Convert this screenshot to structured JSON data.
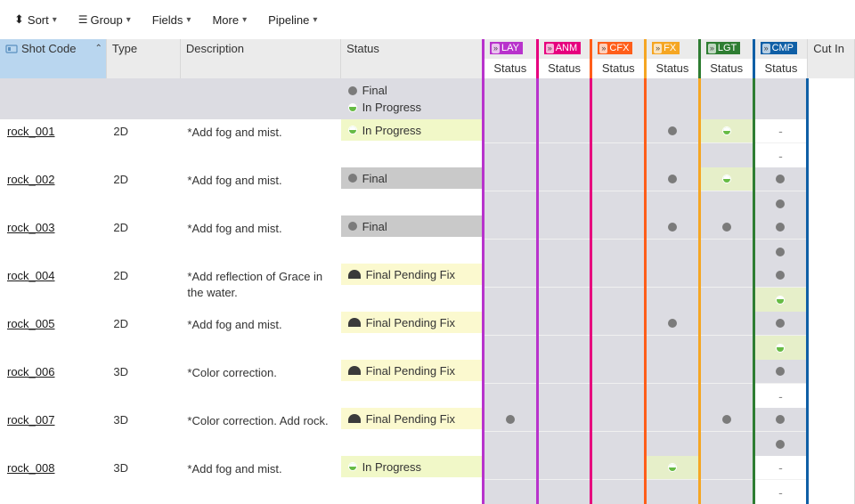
{
  "toolbar": {
    "sort": "Sort",
    "group": "Group",
    "fields": "Fields",
    "more": "More",
    "pipeline": "Pipeline"
  },
  "headers": {
    "shot_code": "Shot Code",
    "type": "Type",
    "description": "Description",
    "status": "Status",
    "cut_in": "Cut In"
  },
  "pipeline_steps": [
    {
      "code": "LAY",
      "color": "#b833cc"
    },
    {
      "code": "ANM",
      "color": "#e6007e"
    },
    {
      "code": "CFX",
      "color": "#ff5e1a"
    },
    {
      "code": "FX",
      "color": "#f5a623"
    },
    {
      "code": "LGT",
      "color": "#2e7d32"
    },
    {
      "code": "CMP",
      "color": "#0f5fa6"
    }
  ],
  "sub_header": "Status",
  "summary": {
    "line1": {
      "icon": "dot-grey",
      "label": "Final"
    },
    "line2": {
      "icon": "dot-green",
      "label": "In Progress"
    }
  },
  "status_labels": {
    "in_progress": "In Progress",
    "final": "Final",
    "final_pending_fix": "Final Pending Fix"
  },
  "rows": [
    {
      "shot": "rock_001",
      "type": "2D",
      "desc": "*Add fog and mist.",
      "status": {
        "kind": "in_progress",
        "label": "In Progress"
      },
      "pipe": [
        {
          "subs": [
            null,
            null
          ]
        },
        {
          "subs": [
            null,
            null
          ]
        },
        {
          "subs": [
            null,
            null
          ]
        },
        {
          "subs": [
            {
              "dot": "grey"
            },
            null
          ]
        },
        {
          "subs": [
            {
              "dot": "green"
            },
            null
          ]
        },
        {
          "subs": [
            {
              "dot": "dash"
            },
            {
              "dot": "dash"
            }
          ]
        }
      ]
    },
    {
      "shot": "rock_002",
      "type": "2D",
      "desc": "*Add fog and mist.",
      "status": {
        "kind": "final",
        "label": "Final"
      },
      "pipe": [
        {
          "subs": [
            null,
            null
          ]
        },
        {
          "subs": [
            null,
            null
          ]
        },
        {
          "subs": [
            null,
            null
          ]
        },
        {
          "subs": [
            {
              "dot": "grey"
            },
            null
          ]
        },
        {
          "subs": [
            {
              "dot": "green"
            },
            null
          ]
        },
        {
          "subs": [
            {
              "dot": "grey"
            },
            {
              "dot": "grey"
            }
          ]
        }
      ]
    },
    {
      "shot": "rock_003",
      "type": "2D",
      "desc": "*Add fog and mist.",
      "status": {
        "kind": "final",
        "label": "Final"
      },
      "pipe": [
        {
          "subs": [
            null,
            null
          ]
        },
        {
          "subs": [
            null,
            null
          ]
        },
        {
          "subs": [
            null,
            null
          ]
        },
        {
          "subs": [
            {
              "dot": "grey"
            },
            null
          ]
        },
        {
          "subs": [
            {
              "dot": "grey"
            },
            null
          ]
        },
        {
          "subs": [
            {
              "dot": "grey"
            },
            {
              "dot": "grey"
            }
          ]
        }
      ]
    },
    {
      "shot": "rock_004",
      "type": "2D",
      "desc": "*Add reflection of Grace in the water.",
      "status": {
        "kind": "pending",
        "label": "Final Pending Fix"
      },
      "pipe": [
        {
          "subs": [
            null,
            null
          ]
        },
        {
          "subs": [
            null,
            null
          ]
        },
        {
          "subs": [
            null,
            null
          ]
        },
        {
          "subs": [
            null,
            null
          ]
        },
        {
          "subs": [
            null,
            null
          ]
        },
        {
          "subs": [
            {
              "dot": "grey"
            },
            {
              "dot": "green"
            }
          ]
        }
      ]
    },
    {
      "shot": "rock_005",
      "type": "2D",
      "desc": "*Add fog and mist.",
      "status": {
        "kind": "pending",
        "label": "Final Pending Fix"
      },
      "pipe": [
        {
          "subs": [
            null,
            null
          ]
        },
        {
          "subs": [
            null,
            null
          ]
        },
        {
          "subs": [
            null,
            null
          ]
        },
        {
          "subs": [
            {
              "dot": "grey"
            },
            null
          ]
        },
        {
          "subs": [
            null,
            null
          ]
        },
        {
          "subs": [
            {
              "dot": "grey"
            },
            {
              "dot": "green"
            }
          ]
        }
      ]
    },
    {
      "shot": "rock_006",
      "type": "3D",
      "desc": "*Color correction.",
      "status": {
        "kind": "pending",
        "label": "Final Pending Fix"
      },
      "pipe": [
        {
          "subs": [
            null,
            null
          ]
        },
        {
          "subs": [
            null,
            null
          ]
        },
        {
          "subs": [
            null,
            null
          ]
        },
        {
          "subs": [
            null,
            null
          ]
        },
        {
          "subs": [
            null,
            null
          ]
        },
        {
          "subs": [
            {
              "dot": "grey"
            },
            {
              "dot": "dash"
            }
          ]
        }
      ]
    },
    {
      "shot": "rock_007",
      "type": "3D",
      "desc": "*Color correction. Add rock.",
      "status": {
        "kind": "pending",
        "label": "Final Pending Fix"
      },
      "pipe": [
        {
          "subs": [
            {
              "dot": "grey"
            },
            null
          ]
        },
        {
          "subs": [
            null,
            null
          ]
        },
        {
          "subs": [
            null,
            null
          ]
        },
        {
          "subs": [
            null,
            null
          ]
        },
        {
          "subs": [
            {
              "dot": "grey"
            },
            null
          ]
        },
        {
          "subs": [
            {
              "dot": "grey"
            },
            {
              "dot": "grey"
            }
          ]
        }
      ]
    },
    {
      "shot": "rock_008",
      "type": "3D",
      "desc": "*Add fog and mist.",
      "status": {
        "kind": "in_progress",
        "label": "In Progress"
      },
      "pipe": [
        {
          "subs": [
            null,
            null
          ]
        },
        {
          "subs": [
            null,
            null
          ]
        },
        {
          "subs": [
            null,
            null
          ]
        },
        {
          "subs": [
            {
              "dot": "green"
            },
            null
          ]
        },
        {
          "subs": [
            null,
            null
          ]
        },
        {
          "subs": [
            {
              "dot": "dash"
            },
            {
              "dot": "dash"
            }
          ]
        }
      ]
    }
  ]
}
